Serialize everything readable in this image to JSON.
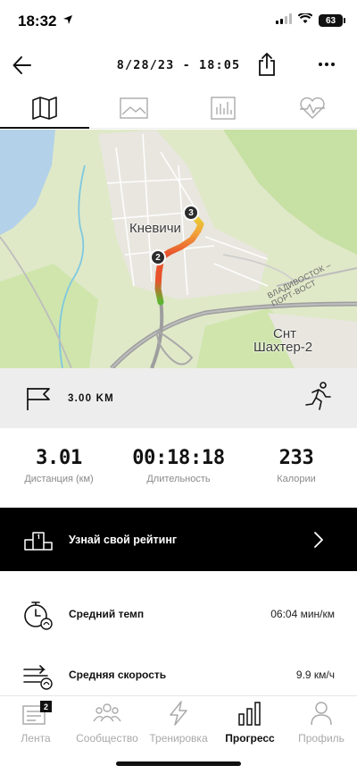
{
  "status_bar": {
    "time": "18:32",
    "battery": "63"
  },
  "header": {
    "title": "8/28/23 - 18:05"
  },
  "tabs": [
    {
      "icon": "map-icon",
      "active": true
    },
    {
      "icon": "image-icon",
      "active": false
    },
    {
      "icon": "bar-chart-icon",
      "active": false
    },
    {
      "icon": "heart-rate-icon",
      "active": false
    }
  ],
  "map": {
    "place_labels": [
      "Кневичи",
      "Снт",
      "Шахтер-2"
    ],
    "road_label": "ВЛАДИВОСТОК – ПОРТ-ВОСТ",
    "km_markers": [
      "2",
      "3"
    ],
    "route_colors": [
      "#5cb531",
      "#e7d233",
      "#f2a33a",
      "#e8532c"
    ]
  },
  "goal": {
    "distance": "3.00 KM"
  },
  "stats": [
    {
      "value": "3.01",
      "label": "Дистанция (км)"
    },
    {
      "value": "00:18:18",
      "label": "Длительность"
    },
    {
      "value": "233",
      "label": "Калории"
    }
  ],
  "rating": {
    "label": "Узнай свой рейтинг"
  },
  "metrics": [
    {
      "label": "Средний темп",
      "value": "06:04 мин/км",
      "icon": "stopwatch-icon"
    },
    {
      "label": "Средняя скорость",
      "value": "9.9 км/ч",
      "icon": "speed-icon"
    }
  ],
  "bottom_nav": {
    "items": [
      {
        "label": "Лента",
        "icon": "feed-icon",
        "badge": "2",
        "active": false
      },
      {
        "label": "Сообщество",
        "icon": "community-icon",
        "active": false
      },
      {
        "label": "Тренировка",
        "icon": "lightning-icon",
        "active": false
      },
      {
        "label": "Прогресс",
        "icon": "progress-icon",
        "active": true
      },
      {
        "label": "Профиль",
        "icon": "profile-icon",
        "active": false
      }
    ]
  },
  "colors": {
    "accent": "#111111",
    "banner_bg": "#000000",
    "goal_bg": "#ededed",
    "muted_text": "#8a8a8a"
  }
}
